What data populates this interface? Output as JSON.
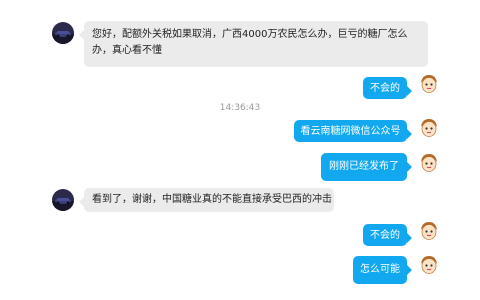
{
  "colors": {
    "outgoing_bubble": "#12a8ef",
    "incoming_bubble": "#ebebeb",
    "timestamp": "#999999"
  },
  "messages": [
    {
      "side": "in",
      "text_lines": [
        "您好，配额外关税如果取消，广西4000万农民怎么办，巨亏的糖厂怎么",
        "办，真心看不懂"
      ]
    },
    {
      "side": "out",
      "text": "不会的"
    },
    {
      "side": "out",
      "text": "看云南糖网微信公众号"
    },
    {
      "side": "out",
      "text": "刚刚已经发布了"
    },
    {
      "side": "in",
      "text": "看到了，谢谢，中国糖业真的不能直接承受巴西的冲击"
    },
    {
      "side": "out",
      "text": "不会的"
    },
    {
      "side": "out",
      "text": "怎么可能"
    }
  ],
  "timestamp": "14:36:43",
  "icons": {
    "sender_avatar": "car-photo-avatar",
    "self_avatar": "cartoon-face-avatar"
  }
}
